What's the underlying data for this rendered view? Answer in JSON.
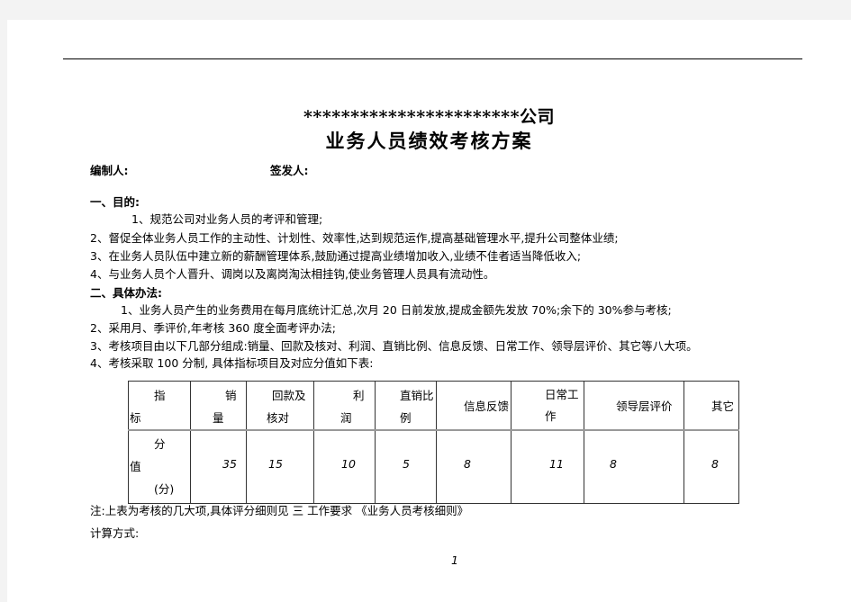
{
  "document": {
    "title_line1": "***********************公司",
    "title_line2": "业务人员绩效考核方案",
    "prepared_by_label": "编制人:",
    "issued_by_label": "签发人:",
    "section1": {
      "heading": "一、目的:",
      "items": [
        "1、规范公司对业务人员的考评和管理;",
        "2、督促全体业务人员工作的主动性、计划性、效率性,达到规范运作,提高基础管理水平,提升公司整体业绩;",
        "3、在业务人员队伍中建立新的薪酬管理体系,鼓励通过提高业绩增加收入,业绩不佳者适当降低收入;",
        "4、与业务人员个人晋升、调岗以及离岗淘汰相挂钩,使业务管理人员具有流动性。"
      ]
    },
    "section2": {
      "heading": "二、具体办法:",
      "items": [
        "1、业务人员产生的业务费用在每月底统计汇总,次月 20 日前发放,提成金额先发放 70%;余下的 30%参与考核;",
        "2、采用月、季评价,年考核 360 度全面考评办法;",
        "3、考核项目由以下几部分组成:销量、回款及核对、利润、直销比例、信息反馈、日常工作、领导层评价、其它等八大项。",
        "4、考核采取 100 分制,  具体指标项目及对应分值如下表:"
      ]
    },
    "table": {
      "header_label_top": "指",
      "header_label_bottom": "标",
      "row_label_top": "分",
      "row_label_mid": "值",
      "row_label_bottom": "(分)",
      "columns": [
        {
          "line1": "销",
          "line2": "量",
          "score": "35"
        },
        {
          "line1": "回款及",
          "line2": "核对",
          "score": "15"
        },
        {
          "line1": "利",
          "line2": "润",
          "score": "10"
        },
        {
          "line1": "直销比",
          "line2": "例",
          "score": "5"
        },
        {
          "line1": "信息反馈",
          "line2": "",
          "score": "8"
        },
        {
          "line1": "日常工",
          "line2": "作",
          "score": "11"
        },
        {
          "line1": "领导层评价",
          "line2": "",
          "score": "8"
        },
        {
          "line1": "其它",
          "line2": "",
          "score": "8"
        }
      ]
    },
    "note": "注:上表为考核的几大项,具体评分细则见  三  工作要求  《业务人员考核细则》",
    "calc_label": "计算方式:",
    "page_number": "1"
  }
}
